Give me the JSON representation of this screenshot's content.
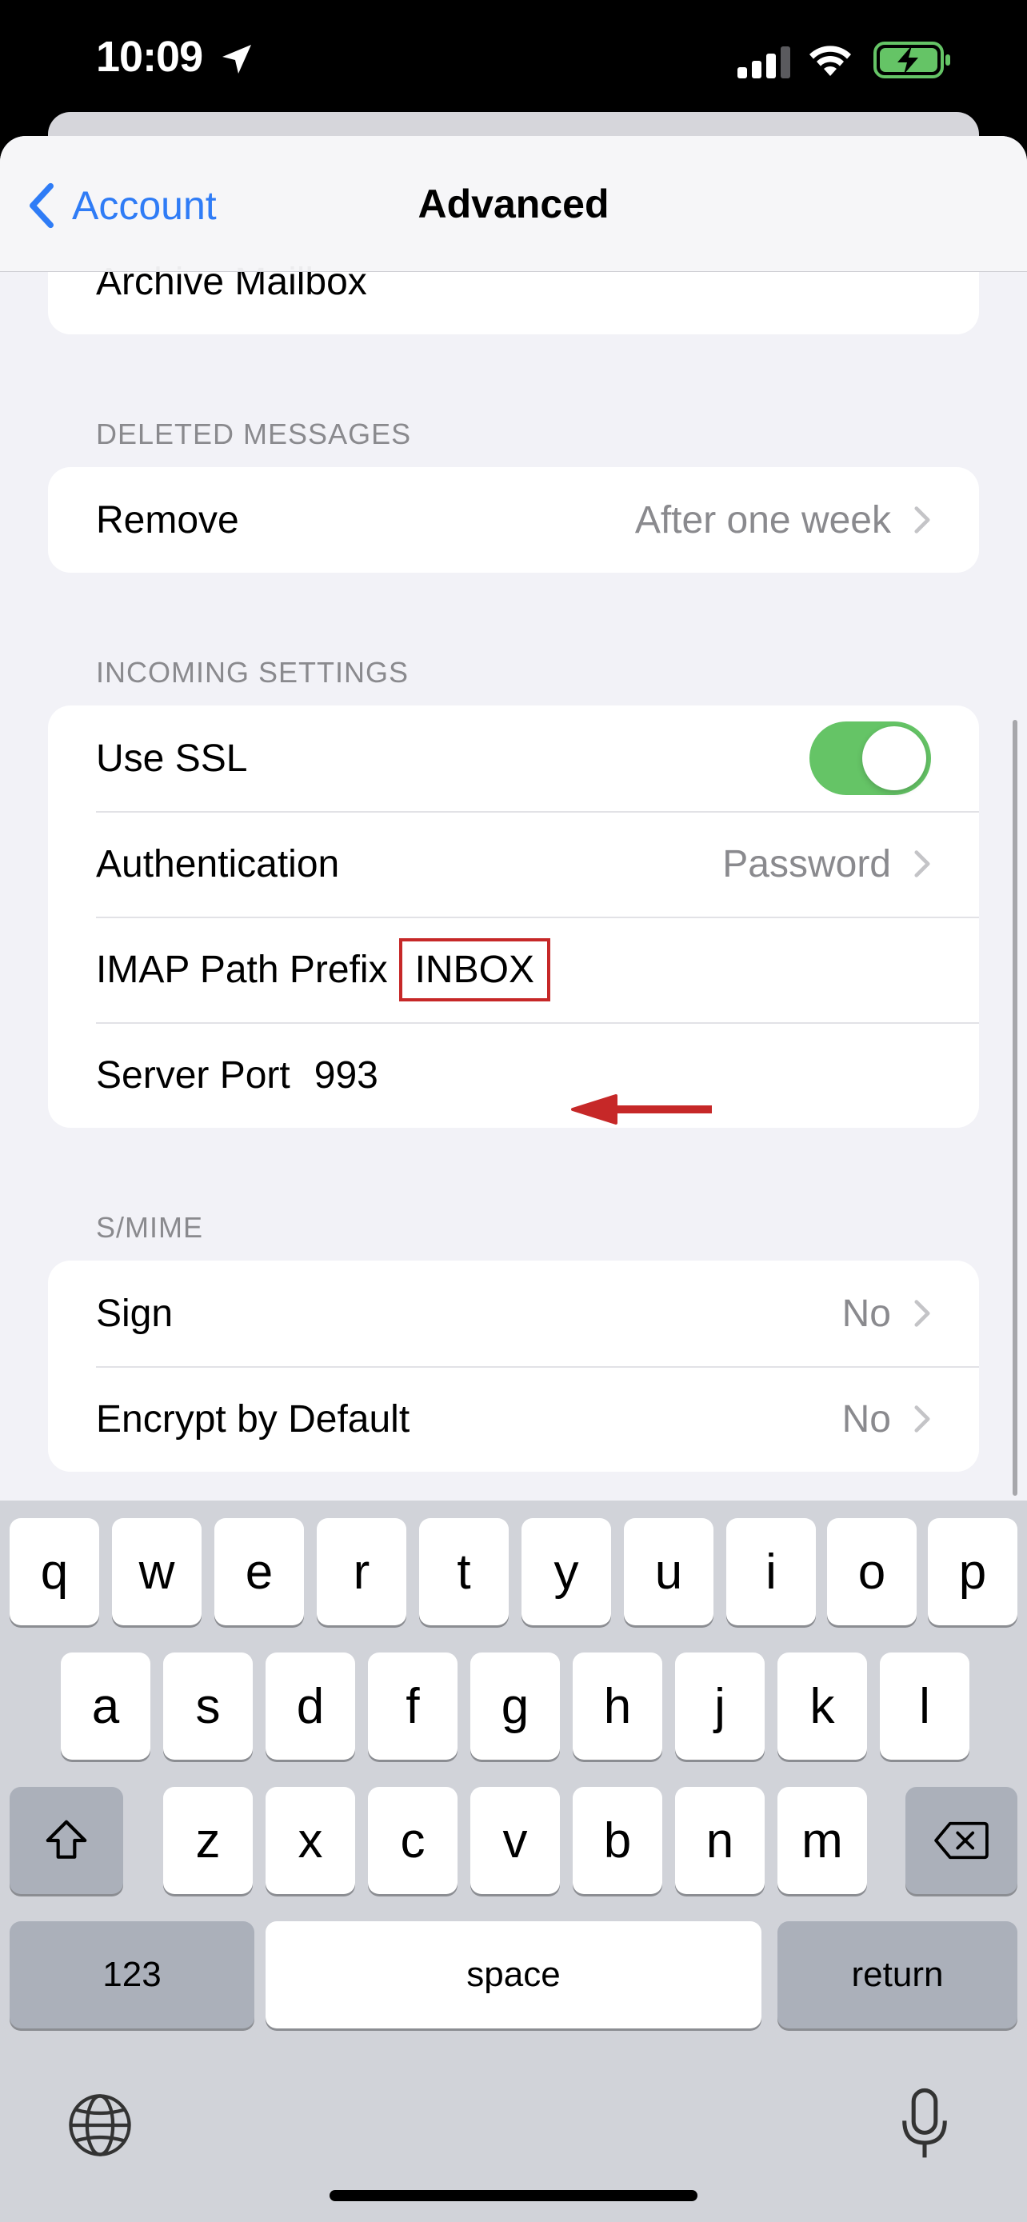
{
  "status_bar": {
    "time": "10:09"
  },
  "nav": {
    "back_label": "Account",
    "title": "Advanced"
  },
  "top_row": {
    "label": "Archive Mailbox"
  },
  "deleted_messages": {
    "header": "DELETED MESSAGES",
    "remove_label": "Remove",
    "remove_value": "After one week"
  },
  "incoming": {
    "header": "INCOMING SETTINGS",
    "use_ssl_label": "Use SSL",
    "use_ssl_on": true,
    "auth_label": "Authentication",
    "auth_value": "Password",
    "imap_label": "IMAP Path Prefix",
    "imap_value": "INBOX",
    "port_label": "Server Port",
    "port_value": "993"
  },
  "smime": {
    "header": "S/MIME",
    "sign_label": "Sign",
    "sign_value": "No",
    "encrypt_label": "Encrypt by Default",
    "encrypt_value": "No"
  },
  "keyboard": {
    "row1": [
      "q",
      "w",
      "e",
      "r",
      "t",
      "y",
      "u",
      "i",
      "o",
      "p"
    ],
    "row2": [
      "a",
      "s",
      "d",
      "f",
      "g",
      "h",
      "j",
      "k",
      "l"
    ],
    "row3": [
      "z",
      "x",
      "c",
      "v",
      "b",
      "n",
      "m"
    ],
    "numbers_label": "123",
    "space_label": "space",
    "return_label": "return"
  },
  "colors": {
    "accent": "#2f7cf6",
    "toggle_on": "#65c466",
    "annotation": "#c62828"
  }
}
